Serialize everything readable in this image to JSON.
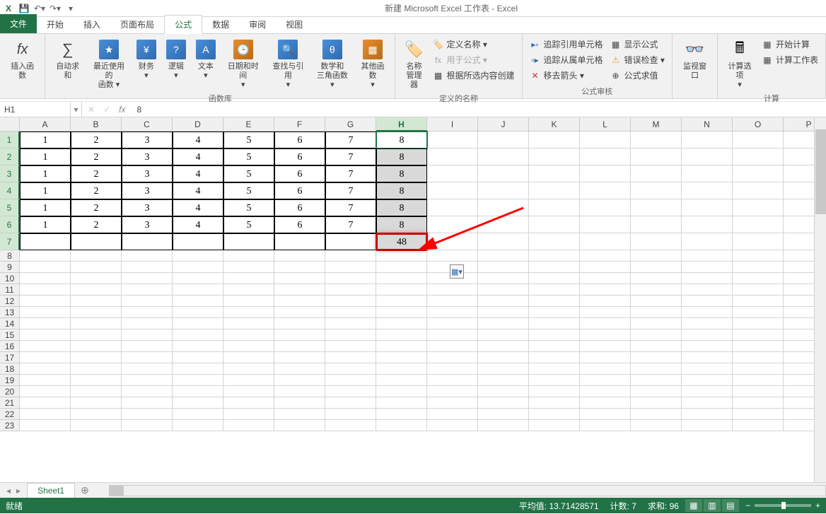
{
  "title": "新建 Microsoft Excel 工作表 - Excel",
  "tabs": {
    "file": "文件",
    "home": "开始",
    "insert": "插入",
    "layout": "页面布局",
    "formula": "公式",
    "data": "数据",
    "review": "审阅",
    "view": "视图"
  },
  "ribbon": {
    "insert_fn": "插入函数",
    "autosum": "自动求和",
    "recent": "最近使用的\n函数 ▾",
    "financial": "财务\n▾",
    "logical": "逻辑\n▾",
    "text": "文本\n▾",
    "datetime": "日期和时间\n▾",
    "lookup": "查找与引用\n▾",
    "math": "数学和\n三角函数 ▾",
    "more": "其他函数\n▾",
    "group_lib": "函数库",
    "name_mgr": "名称\n管理器",
    "def_name": "定义名称 ▾",
    "use_formula": "用于公式 ▾",
    "create_sel": "根据所选内容创建",
    "group_names": "定义的名称",
    "trace_prec": "追踪引用单元格",
    "trace_dep": "追踪从属单元格",
    "remove_arrows": "移去箭头 ▾",
    "show_formula": "显示公式",
    "error_check": "错误检查 ▾",
    "eval": "公式求值",
    "group_audit": "公式审核",
    "watch": "监视窗口",
    "calc_opts": "计算选项\n▾",
    "calc_now": "开始计算",
    "calc_sheet": "计算工作表",
    "group_calc": "计算"
  },
  "namebox": "H1",
  "formula": "8",
  "columns": [
    "A",
    "B",
    "C",
    "D",
    "E",
    "F",
    "G",
    "H",
    "I",
    "J",
    "K",
    "L",
    "M",
    "N",
    "O",
    "P"
  ],
  "sel_col_index": 7,
  "data_rows": 6,
  "row_heights": {
    "data": 24,
    "empty": 16
  },
  "cells": [
    [
      "1",
      "2",
      "3",
      "4",
      "5",
      "6",
      "7",
      "8"
    ],
    [
      "1",
      "2",
      "3",
      "4",
      "5",
      "6",
      "7",
      "8"
    ],
    [
      "1",
      "2",
      "3",
      "4",
      "5",
      "6",
      "7",
      "8"
    ],
    [
      "1",
      "2",
      "3",
      "4",
      "5",
      "6",
      "7",
      "8"
    ],
    [
      "1",
      "2",
      "3",
      "4",
      "5",
      "6",
      "7",
      "8"
    ],
    [
      "1",
      "2",
      "3",
      "4",
      "5",
      "6",
      "7",
      "8"
    ]
  ],
  "sum_value": "48",
  "sheet": "Sheet1",
  "status": {
    "ready": "就绪",
    "avg_label": "平均值:",
    "avg": "13.71428571",
    "count_label": "计数:",
    "count": "7",
    "sum_label": "求和:",
    "sum": "96",
    "zoom": "100%"
  }
}
